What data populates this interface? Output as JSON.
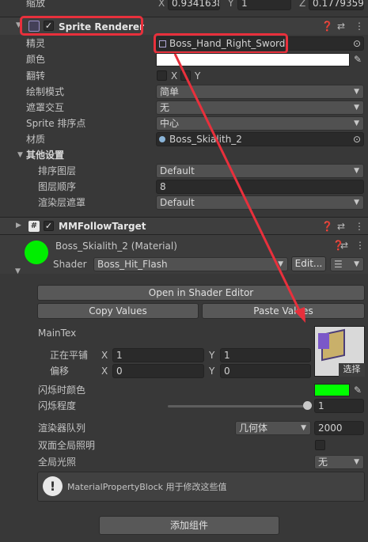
{
  "top_row": {
    "label": "缩放",
    "x_label": "X",
    "x_value": "0.9341638",
    "y_label": "Y",
    "y_value": "1",
    "z_label": "Z",
    "z_value": "0.1779359"
  },
  "sprite_renderer": {
    "title": "Sprite Renderer",
    "sprite_label": "精灵",
    "sprite_value": "Boss_Hand_Right_Sword",
    "color_label": "颜色",
    "flip_label": "翻转",
    "flip_x": "X",
    "flip_y": "Y",
    "draw_mode_label": "绘制模式",
    "draw_mode_value": "简单",
    "mask_label": "遮罩交互",
    "mask_value": "无",
    "sort_point_label": "Sprite 排序点",
    "sort_point_value": "中心",
    "material_label": "材质",
    "material_value": "Boss_Skialith_2",
    "other_settings_label": "其他设置",
    "sorting_layer_label": "排序图层",
    "sorting_layer_value": "Default",
    "order_label": "图层顺序",
    "order_value": "8",
    "rendering_layer_label": "渲染层遮罩",
    "rendering_layer_value": "Default"
  },
  "follow_target": {
    "title": "MMFollowTarget"
  },
  "material": {
    "name": "Boss_Skialith_2 (Material)",
    "shader_label": "Shader",
    "shader_value": "Boss_Hit_Flash",
    "edit_label": "Edit...",
    "open_editor": "Open in Shader Editor",
    "copy_values": "Copy Values",
    "paste_values": "Paste Values",
    "main_tex_label": "MainTex",
    "tiling_label": "正在平铺",
    "tiling_x": "1",
    "tiling_y": "1",
    "offset_label": "偏移",
    "offset_x": "0",
    "offset_y": "0",
    "x_label": "X",
    "y_label": "Y",
    "select_label": "选择",
    "flash_color_label": "闪烁时颜色",
    "flash_amount_label": "闪烁程度",
    "flash_amount_value": "1",
    "flash_amount_fraction": 1.0,
    "render_queue_label": "渲染器队列",
    "render_queue_mode": "几何体",
    "render_queue_value": "2000",
    "double_gi_label": "双面全局照明",
    "global_illum_label": "全局光照",
    "global_illum_value": "无",
    "info_text": "MaterialPropertyBlock 用于修改这些值"
  },
  "add_component": "添加组件",
  "colors": {
    "flash_color": "#00ff00",
    "material_swatch": "#00ee00",
    "highlight": "#e8303c",
    "sprite_color": "#ffffff"
  },
  "icons": [
    "sprite-renderer-icon",
    "script-icon",
    "help-icon",
    "settings-icon",
    "more-icon",
    "target-icon",
    "eyedropper-icon",
    "warning-icon"
  ]
}
